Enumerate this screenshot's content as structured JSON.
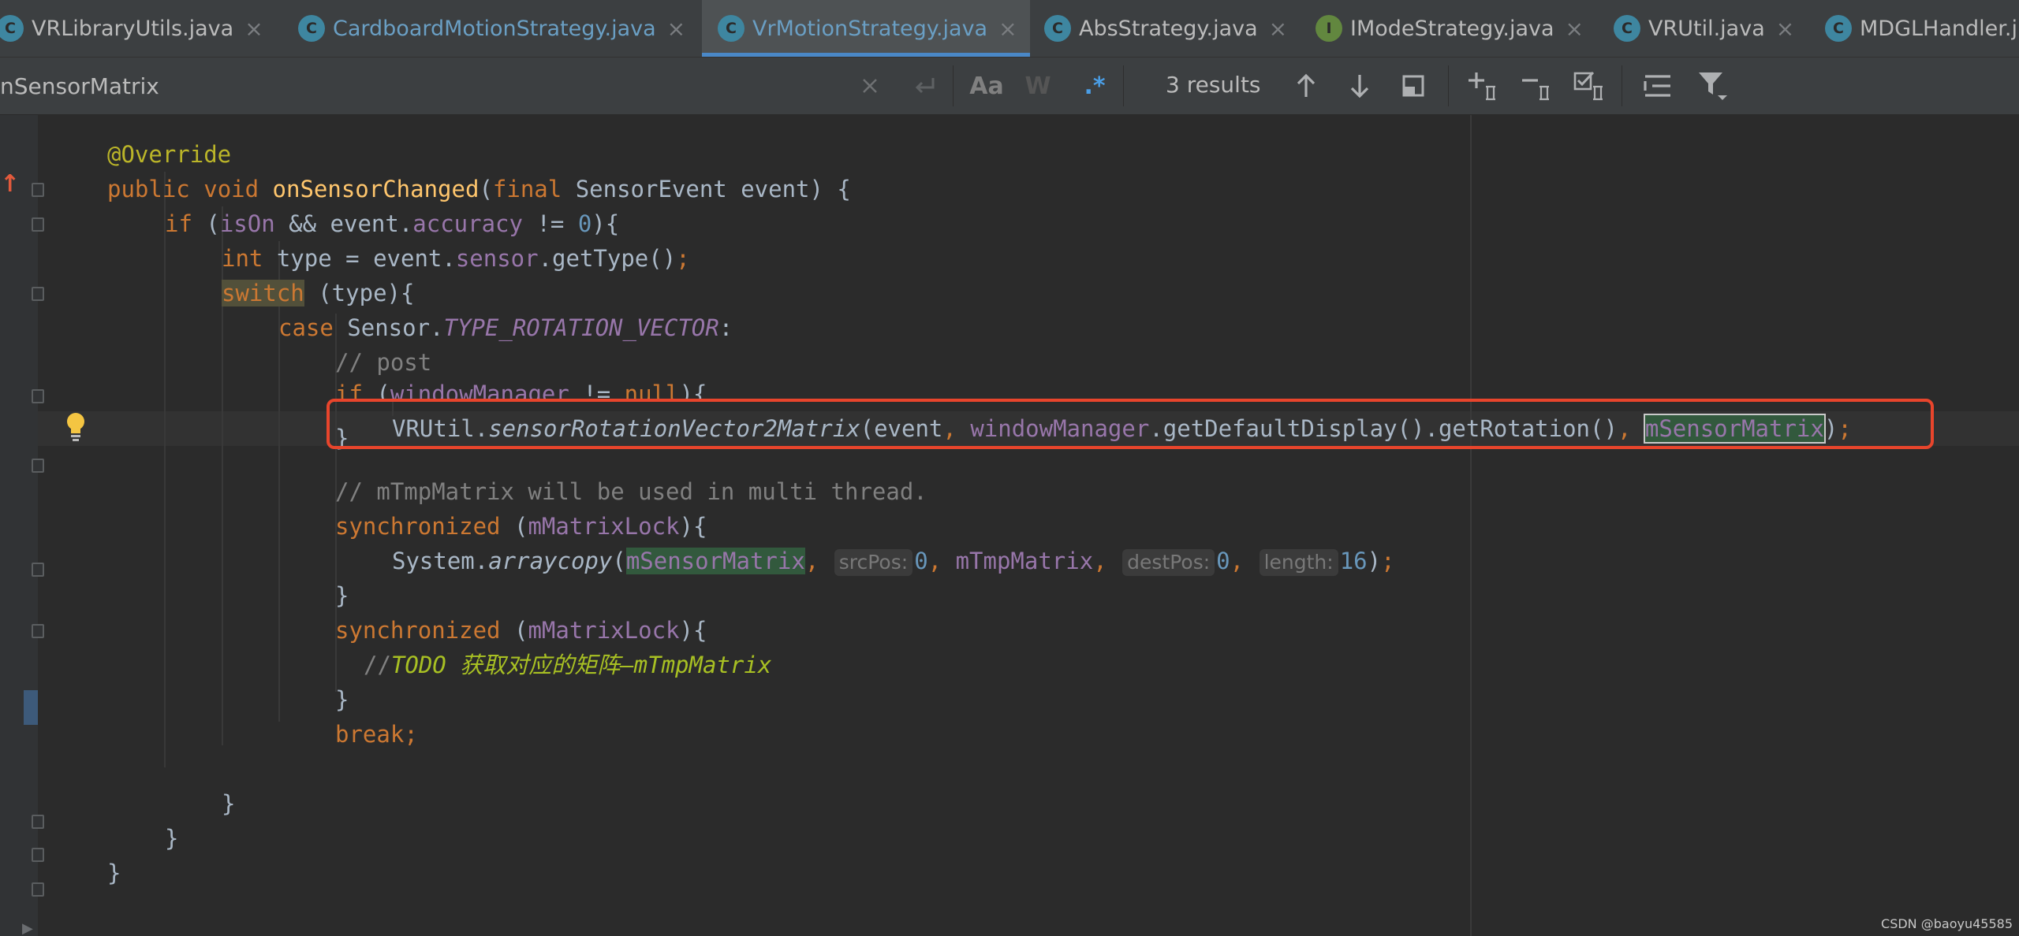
{
  "tabs": [
    {
      "label": "VRLibraryUtils.java",
      "icon": "class-icon",
      "active": false
    },
    {
      "label": "CardboardMotionStrategy.java",
      "icon": "class-icon",
      "active": false
    },
    {
      "label": "VrMotionStrategy.java",
      "icon": "class-icon",
      "active": true
    },
    {
      "label": "AbsStrategy.java",
      "icon": "abstract-class-icon",
      "active": false
    },
    {
      "label": "IModeStrategy.java",
      "icon": "interface-icon",
      "active": false
    },
    {
      "label": "VRUtil.java",
      "icon": "class-icon",
      "active": false
    },
    {
      "label": "MDGLHandler.j",
      "icon": "class-icon",
      "active": false
    }
  ],
  "tab_icon_letters": {
    "class": "C",
    "interface": "I"
  },
  "tab_close_glyph": "×",
  "search": {
    "value": "nSensorMatrix",
    "results": "3 results",
    "match_case_label": "Aa",
    "words_label": "W",
    "regex_label": ".*"
  },
  "code": {
    "l1": {
      "ann": "@Override"
    },
    "l2": {
      "kw1": "public",
      "kw2": "void",
      "fn": "onSensorChanged",
      "p1": "(",
      "kw3": "final",
      "rest": " SensorEvent event) {"
    },
    "l3": {
      "kw": "if",
      "p1": " (",
      "field1": "isOn",
      "p2": " && event.",
      "field2": "accuracy",
      "p3": " != ",
      "num": "0",
      "p4": "){"
    },
    "l4": {
      "kw": "int",
      "p1": " type = event.",
      "field": "sensor",
      "p2": ".getType()",
      "semi": ";"
    },
    "l5": {
      "kw": "switch",
      "p1": " (type){"
    },
    "l6": {
      "kw": "case",
      "p1": " Sensor.",
      "static": "TYPE_ROTATION_VECTOR",
      "p2": ":"
    },
    "l7": {
      "cmt": "// post"
    },
    "l8": {
      "kw1": "if",
      "p1": " (",
      "field": "windowManager",
      "p2": " != ",
      "kw2": "null",
      "p3": "){"
    },
    "l9": {
      "p1": "VRUtil.",
      "method": "sensorRotationVector2Matrix",
      "p2": "(event",
      "comma1": ",",
      "field1": "windowManager",
      "p3": ".getDefaultDisplay().getRotation()",
      "comma2": ",",
      "match": "mSensorMatrix",
      "p4": ")",
      "semi": ";"
    },
    "l10": {
      "p1": "}"
    },
    "l11": {
      "cmt": "// mTmpMatrix will be used in multi thread."
    },
    "l12": {
      "kw": "synchronized",
      "p1": " (",
      "field": "mMatrixLock",
      "p2": "){"
    },
    "l13": {
      "p1": "System.",
      "method": "arraycopy",
      "p2": "(",
      "match": "mSensorMatrix",
      "comma1": ",",
      "hint1": "srcPos:",
      "num1": "0",
      "comma2": ",",
      "field": "mTmpMatrix",
      "comma3": ",",
      "hint2": "destPos:",
      "num2": "0",
      "comma4": ",",
      "hint3": "length:",
      "num3": "16",
      "p3": ")",
      "semi": ";"
    },
    "l14": {
      "p1": "}"
    },
    "l15": {
      "kw": "synchronized",
      "p1": " (",
      "field": "mMatrixLock",
      "p2": "){"
    },
    "l16": {
      "cmt": "//",
      "todo": "TODO 获取对应的矩阵—mTmpMatrix"
    },
    "l17": {
      "p1": "}"
    },
    "l18": {
      "kw": "break",
      "semi": ";"
    },
    "l19": {
      "p1": "}"
    },
    "l20": {
      "p1": "}"
    },
    "l21": {
      "p1": "}"
    }
  },
  "watermark": "CSDN @baoyu45585",
  "colors": {
    "highlight_box": "#e8452c",
    "active_tab_underline": "#4a88c7"
  }
}
